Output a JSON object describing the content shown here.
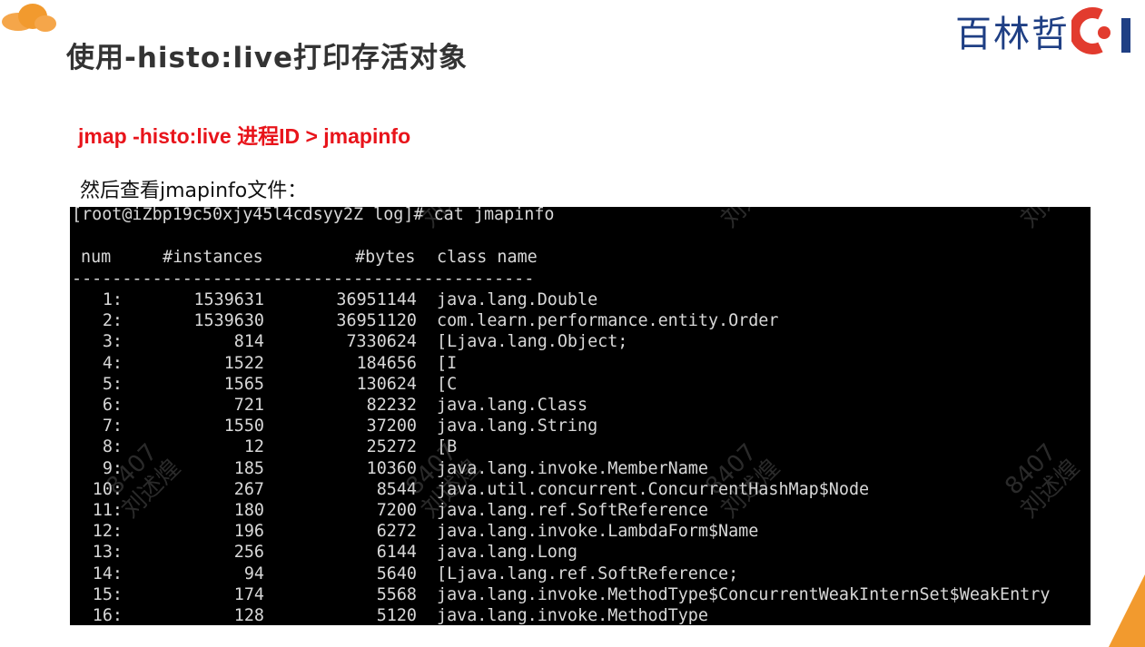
{
  "slide": {
    "title": "使用-histo:live打印存活对象",
    "logo_text": "百林哲",
    "command": "jmap -histo:live 进程ID > jmapinfo",
    "subtitle": "然后查看jmapinfo文件："
  },
  "terminal": {
    "prompt": "[root@iZbp19c50xjy45l4cdsyy2Z log]# cat jmapinfo",
    "headers": {
      "num": "num",
      "instances": "#instances",
      "bytes": "#bytes",
      "class": "class name"
    },
    "divider": "----------------------------------------------",
    "rows": [
      {
        "num": "1:",
        "instances": "1539631",
        "bytes": "36951144",
        "class": "java.lang.Double"
      },
      {
        "num": "2:",
        "instances": "1539630",
        "bytes": "36951120",
        "class": "com.learn.performance.entity.Order"
      },
      {
        "num": "3:",
        "instances": "814",
        "bytes": "7330624",
        "class": "[Ljava.lang.Object;"
      },
      {
        "num": "4:",
        "instances": "1522",
        "bytes": "184656",
        "class": "[I"
      },
      {
        "num": "5:",
        "instances": "1565",
        "bytes": "130624",
        "class": "[C"
      },
      {
        "num": "6:",
        "instances": "721",
        "bytes": "82232",
        "class": "java.lang.Class"
      },
      {
        "num": "7:",
        "instances": "1550",
        "bytes": "37200",
        "class": "java.lang.String"
      },
      {
        "num": "8:",
        "instances": "12",
        "bytes": "25272",
        "class": "[B"
      },
      {
        "num": "9:",
        "instances": "185",
        "bytes": "10360",
        "class": "java.lang.invoke.MemberName"
      },
      {
        "num": "10:",
        "instances": "267",
        "bytes": "8544",
        "class": "java.util.concurrent.ConcurrentHashMap$Node"
      },
      {
        "num": "11:",
        "instances": "180",
        "bytes": "7200",
        "class": "java.lang.ref.SoftReference"
      },
      {
        "num": "12:",
        "instances": "196",
        "bytes": "6272",
        "class": "java.lang.invoke.LambdaForm$Name"
      },
      {
        "num": "13:",
        "instances": "256",
        "bytes": "6144",
        "class": "java.lang.Long"
      },
      {
        "num": "14:",
        "instances": "94",
        "bytes": "5640",
        "class": "[Ljava.lang.ref.SoftReference;"
      },
      {
        "num": "15:",
        "instances": "174",
        "bytes": "5568",
        "class": "java.lang.invoke.MethodType$ConcurrentWeakInternSet$WeakEntry"
      },
      {
        "num": "16:",
        "instances": "128",
        "bytes": "5120",
        "class": "java.lang.invoke.MethodType"
      }
    ]
  },
  "watermark": {
    "text": "8407\n刘述煌"
  },
  "colors": {
    "command": "#e8141b",
    "logo_blue": "#1f3f84",
    "logo_red": "#e23b2e",
    "accent_orange": "#f29a2e"
  }
}
